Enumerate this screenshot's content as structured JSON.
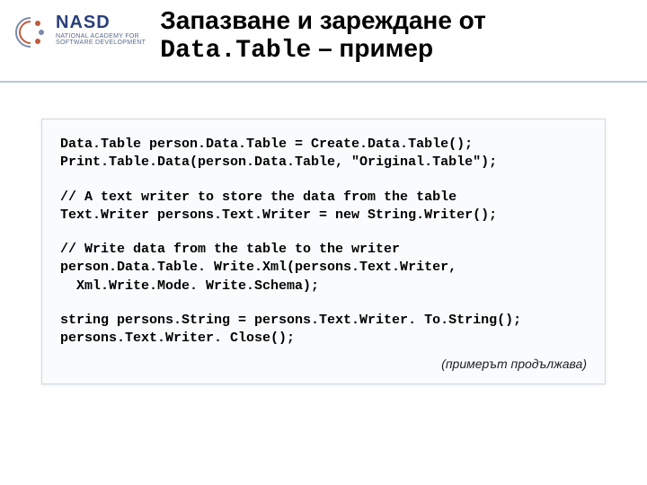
{
  "logo": {
    "main": "NASD",
    "sub": "NATIONAL ACADEMY FOR\nSOFTWARE DEVELOPMENT"
  },
  "title": {
    "line1": "Запазване и зареждане от",
    "line2_mono": "Data.Table",
    "line2_rest": " – пример"
  },
  "code": {
    "l1": "Data.Table person.Data.Table = Create.Data.Table();",
    "l2": "Print.Table.Data(person.Data.Table, \"Original.Table\");",
    "l3": "// A text writer to store the data from the table",
    "l4": "Text.Writer persons.Text.Writer = new String.Writer();",
    "l5": "// Write data from the table to the writer",
    "l6": "person.Data.Table. Write.Xml(persons.Text.Writer,",
    "l7": "  Xml.Write.Mode. Write.Schema);",
    "l8": "string persons.String = persons.Text.Writer. To.String();",
    "l9": "persons.Text.Writer. Close();"
  },
  "continues": "(примерът продължава)"
}
